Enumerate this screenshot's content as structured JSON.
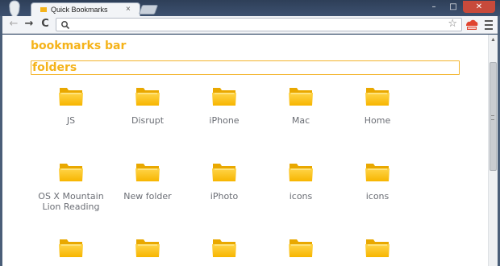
{
  "tab": {
    "title": "Quick Bookmarks",
    "close": "×"
  },
  "window": {
    "minimize": "–",
    "maximize": "□",
    "close": "✕"
  },
  "toolbar": {
    "back": "←",
    "forward": "→",
    "reload": "C",
    "address": ""
  },
  "page": {
    "bookmarks_bar": "bookmarks bar",
    "folders_heading": "folders",
    "folders": [
      {
        "label": "JS"
      },
      {
        "label": "Disrupt"
      },
      {
        "label": "iPhone"
      },
      {
        "label": "Mac"
      },
      {
        "label": "Home"
      },
      {
        "label": "OS X Mountain Lion Reading"
      },
      {
        "label": "New folder"
      },
      {
        "label": "iPhoto"
      },
      {
        "label": "icons"
      },
      {
        "label": "icons"
      },
      {
        "label": ""
      },
      {
        "label": ""
      },
      {
        "label": ""
      },
      {
        "label": ""
      },
      {
        "label": ""
      }
    ]
  },
  "colors": {
    "accent": "#f5b31a",
    "folder_top": "#ffd54a",
    "folder_bottom": "#f7b500"
  },
  "icons": [
    "search-icon",
    "star-icon",
    "extension-icon",
    "menu-icon",
    "folder-icon"
  ]
}
